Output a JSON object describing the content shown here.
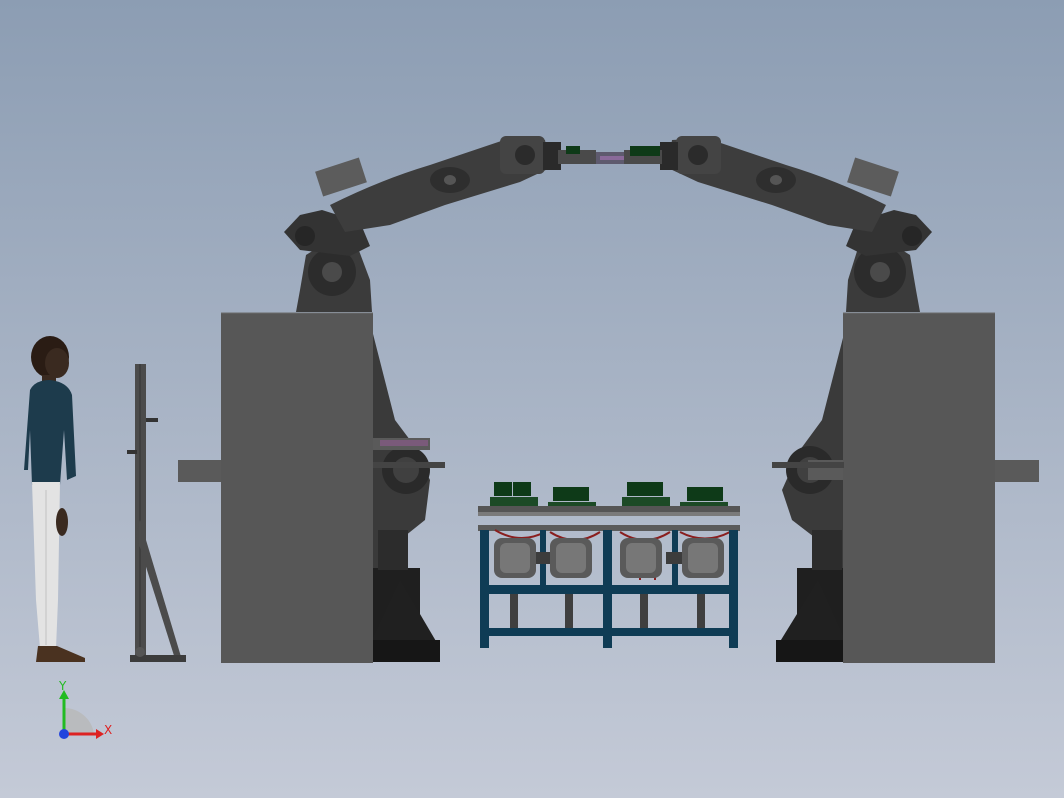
{
  "viewport": {
    "background_top": "#8c9db3",
    "background_bottom": "#c4cad7"
  },
  "scene": {
    "objects": [
      "human-figure",
      "fixture-stand",
      "left-robot-pedestal",
      "right-robot-pedestal",
      "left-industrial-robot",
      "right-industrial-robot",
      "workpiece-fixture-station"
    ],
    "colors": {
      "pedestal": "#575757",
      "robot": "#3e3e3e",
      "robot_dark": "#252525",
      "fixture_frame": "#0f3c55",
      "electronics": "#0e3a18",
      "accent_red": "#8a1e1e",
      "shirt": "#1d3b4c",
      "pants": "#e3e3e3"
    }
  },
  "triad": {
    "x_label": "X",
    "y_label": "Y",
    "x_color": "#dd2222",
    "y_color": "#22bb22",
    "z_color": "#2244dd",
    "icon": "coordinate-triad-icon"
  }
}
